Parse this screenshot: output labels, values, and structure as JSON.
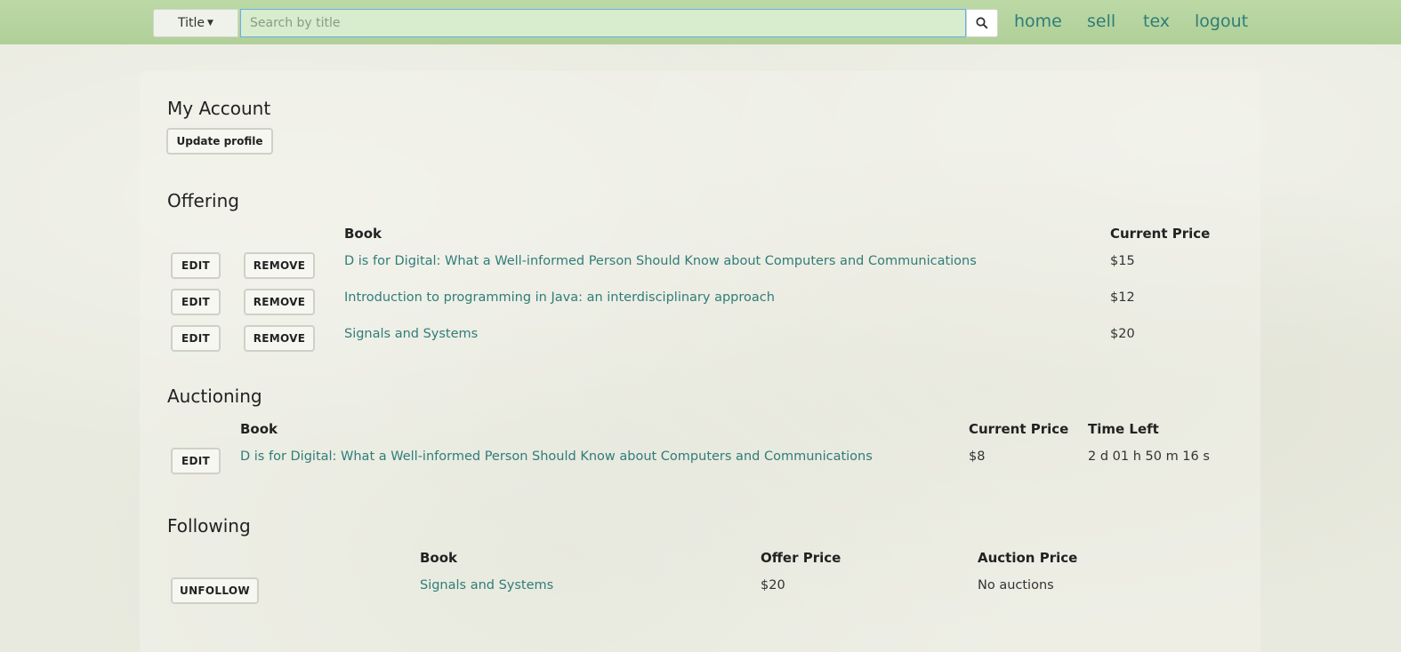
{
  "header": {
    "filter_label": "Title",
    "search_placeholder": "Search by title",
    "search_value": "",
    "nav": [
      "home",
      "sell",
      "tex",
      "logout"
    ]
  },
  "account": {
    "title": "My Account",
    "update_label": "Update profile"
  },
  "offering": {
    "title": "Offering",
    "col_book": "Book",
    "col_price": "Current Price",
    "edit_label": "EDIT",
    "remove_label": "REMOVE",
    "rows": [
      {
        "book": "D is for Digital: What a Well-informed Person Should Know about Computers and Communications",
        "price": "$15"
      },
      {
        "book": "Introduction to programming in Java: an interdisciplinary approach",
        "price": "$12"
      },
      {
        "book": "Signals and Systems",
        "price": "$20"
      }
    ]
  },
  "auctioning": {
    "title": "Auctioning",
    "col_book": "Book",
    "col_price": "Current Price",
    "col_time": "Time Left",
    "edit_label": "EDIT",
    "rows": [
      {
        "book": "D is for Digital: What a Well-informed Person Should Know about Computers and Communications",
        "price": "$8",
        "time": "2 d 01 h 50 m 16 s"
      }
    ]
  },
  "following": {
    "title": "Following",
    "col_book": "Book",
    "col_offer": "Offer Price",
    "col_auction": "Auction Price",
    "unfollow_label": "UNFOLLOW",
    "rows": [
      {
        "book": "Signals and Systems",
        "offer": "$20",
        "auction": "No auctions"
      }
    ]
  },
  "colors": {
    "topbar": "#b5d39e",
    "link": "#2f7d78",
    "search_border": "#66afe9"
  }
}
